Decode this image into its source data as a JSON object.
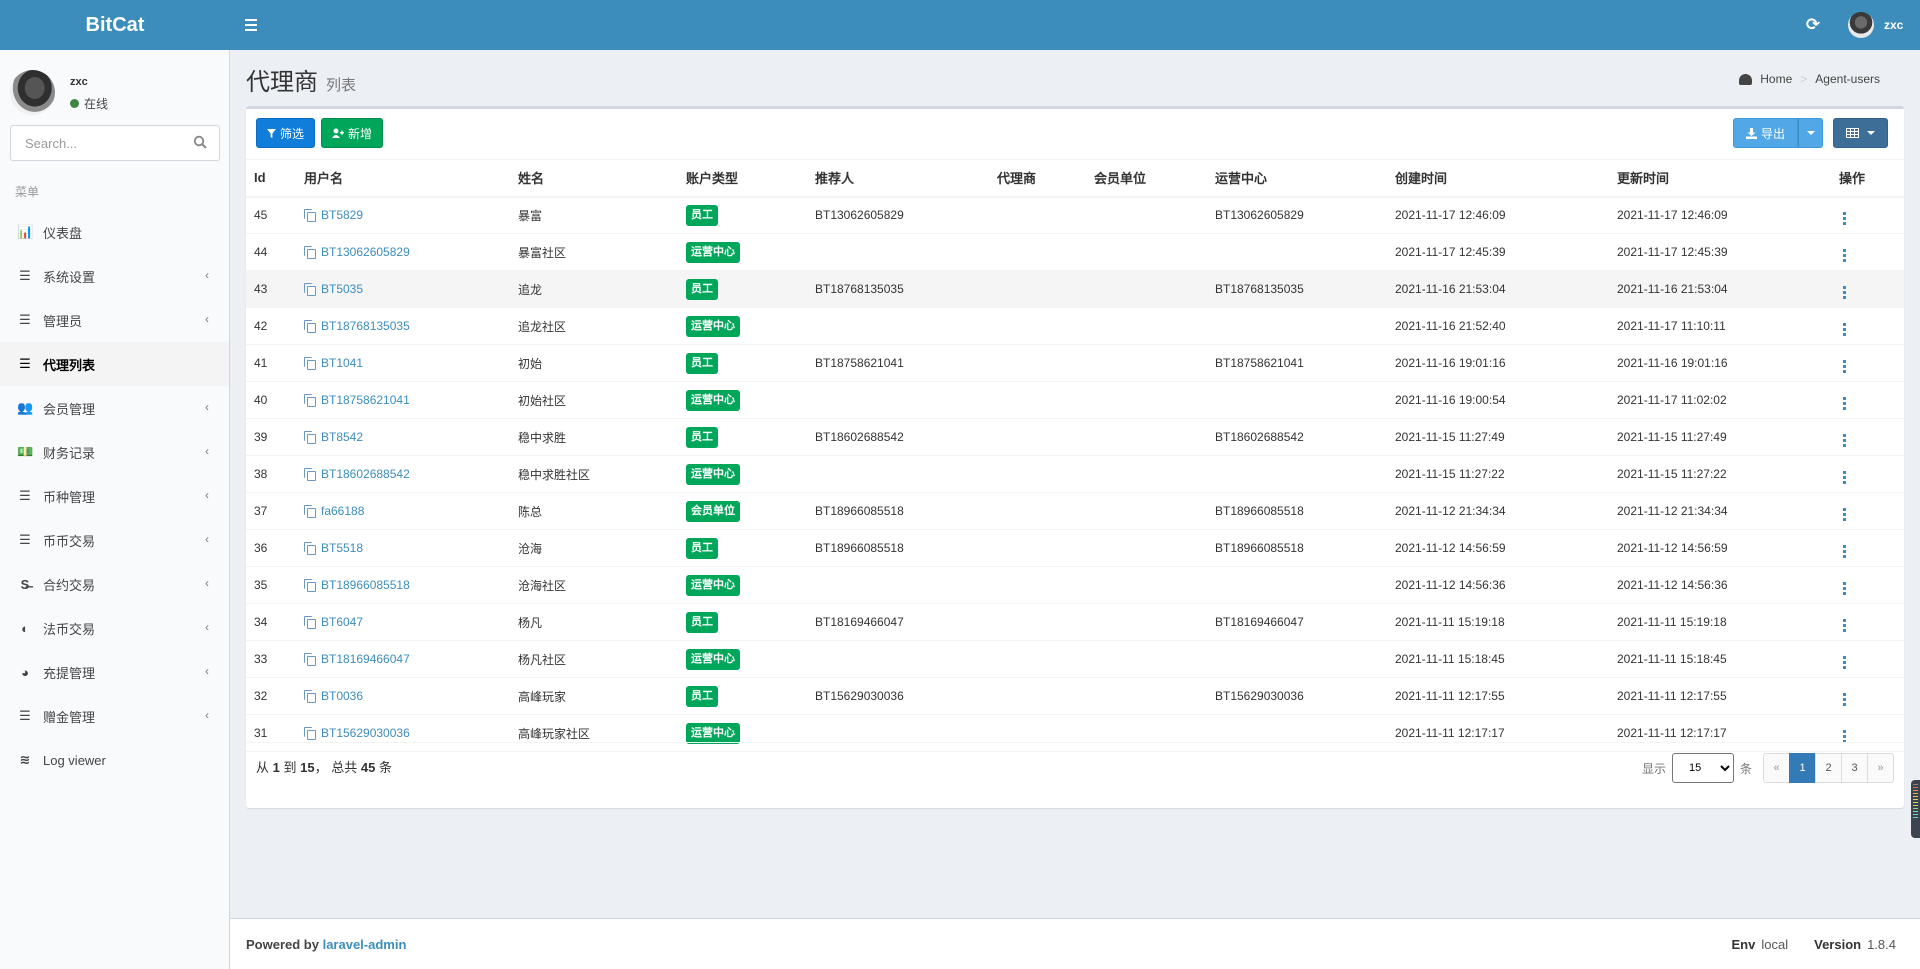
{
  "header": {
    "logo": "BitCat",
    "username": "zxc"
  },
  "sidebar": {
    "user": {
      "name": "zxc",
      "status": "在线"
    },
    "search_placeholder": "Search...",
    "menu_header": "菜单",
    "items": [
      {
        "label": "仪表盘",
        "icon": "bar-chart-icon",
        "glyph": "📊",
        "has_children": false,
        "active": false
      },
      {
        "label": "系统设置",
        "icon": "sliders-icon",
        "glyph": "☰",
        "has_children": true,
        "active": false
      },
      {
        "label": "管理员",
        "icon": "tasks-icon",
        "glyph": "☰",
        "has_children": true,
        "active": false
      },
      {
        "label": "代理列表",
        "icon": "bars-icon",
        "glyph": "☰",
        "has_children": false,
        "active": true
      },
      {
        "label": "会员管理",
        "icon": "users-icon",
        "glyph": "👥",
        "has_children": true,
        "active": false
      },
      {
        "label": "财务记录",
        "icon": "money-icon",
        "glyph": "💵",
        "has_children": true,
        "active": false
      },
      {
        "label": "币种管理",
        "icon": "bars-icon",
        "glyph": "☰",
        "has_children": true,
        "active": false
      },
      {
        "label": "币币交易",
        "icon": "bars-icon",
        "glyph": "☰",
        "has_children": true,
        "active": false
      },
      {
        "label": "合约交易",
        "icon": "strikethrough-icon",
        "glyph": "S̶",
        "has_children": true,
        "active": false
      },
      {
        "label": "法币交易",
        "icon": "adjust-icon",
        "glyph": "◐",
        "has_children": true,
        "active": false
      },
      {
        "label": "充提管理",
        "icon": "dashboard-icon",
        "glyph": "◕",
        "has_children": true,
        "active": false
      },
      {
        "label": "赠金管理",
        "icon": "bars-icon",
        "glyph": "☰",
        "has_children": true,
        "active": false
      },
      {
        "label": "Log viewer",
        "icon": "database-icon",
        "glyph": "≋",
        "has_children": false,
        "active": false
      }
    ]
  },
  "page": {
    "title": "代理商",
    "subtitle": "列表",
    "breadcrumb": [
      "Home",
      "Agent-users"
    ]
  },
  "toolbar": {
    "filter_label": "筛选",
    "new_label": "新增",
    "export_label": "导出"
  },
  "table": {
    "columns": [
      "Id",
      "用户名",
      "姓名",
      "账户类型",
      "推荐人",
      "代理商",
      "会员单位",
      "运营中心",
      "创建时间",
      "更新时间",
      "操作"
    ],
    "rows": [
      {
        "id": "45",
        "username": "BT5829",
        "name": "暴富",
        "type": "员工",
        "referrer": "BT13062605829",
        "agent": "",
        "member_unit": "",
        "ops_center": "BT13062605829",
        "created": "2021-11-17 12:46:09",
        "updated": "2021-11-17 12:46:09"
      },
      {
        "id": "44",
        "username": "BT13062605829",
        "name": "暴富社区",
        "type": "运营中心",
        "referrer": "",
        "agent": "",
        "member_unit": "",
        "ops_center": "",
        "created": "2021-11-17 12:45:39",
        "updated": "2021-11-17 12:45:39"
      },
      {
        "id": "43",
        "username": "BT5035",
        "name": "追龙",
        "type": "员工",
        "referrer": "BT18768135035",
        "agent": "",
        "member_unit": "",
        "ops_center": "BT18768135035",
        "created": "2021-11-16 21:53:04",
        "updated": "2021-11-16 21:53:04"
      },
      {
        "id": "42",
        "username": "BT18768135035",
        "name": "追龙社区",
        "type": "运营中心",
        "referrer": "",
        "agent": "",
        "member_unit": "",
        "ops_center": "",
        "created": "2021-11-16 21:52:40",
        "updated": "2021-11-17 11:10:11"
      },
      {
        "id": "41",
        "username": "BT1041",
        "name": "初始",
        "type": "员工",
        "referrer": "BT18758621041",
        "agent": "",
        "member_unit": "",
        "ops_center": "BT18758621041",
        "created": "2021-11-16 19:01:16",
        "updated": "2021-11-16 19:01:16"
      },
      {
        "id": "40",
        "username": "BT18758621041",
        "name": "初始社区",
        "type": "运营中心",
        "referrer": "",
        "agent": "",
        "member_unit": "",
        "ops_center": "",
        "created": "2021-11-16 19:00:54",
        "updated": "2021-11-17 11:02:02"
      },
      {
        "id": "39",
        "username": "BT8542",
        "name": "稳中求胜",
        "type": "员工",
        "referrer": "BT18602688542",
        "agent": "",
        "member_unit": "",
        "ops_center": "BT18602688542",
        "created": "2021-11-15 11:27:49",
        "updated": "2021-11-15 11:27:49"
      },
      {
        "id": "38",
        "username": "BT18602688542",
        "name": "稳中求胜社区",
        "type": "运营中心",
        "referrer": "",
        "agent": "",
        "member_unit": "",
        "ops_center": "",
        "created": "2021-11-15 11:27:22",
        "updated": "2021-11-15 11:27:22"
      },
      {
        "id": "37",
        "username": "fa66188",
        "name": "陈总",
        "type": "会员单位",
        "referrer": "BT18966085518",
        "agent": "",
        "member_unit": "",
        "ops_center": "BT18966085518",
        "created": "2021-11-12 21:34:34",
        "updated": "2021-11-12 21:34:34"
      },
      {
        "id": "36",
        "username": "BT5518",
        "name": "沧海",
        "type": "员工",
        "referrer": "BT18966085518",
        "agent": "",
        "member_unit": "",
        "ops_center": "BT18966085518",
        "created": "2021-11-12 14:56:59",
        "updated": "2021-11-12 14:56:59"
      },
      {
        "id": "35",
        "username": "BT18966085518",
        "name": "沧海社区",
        "type": "运营中心",
        "referrer": "",
        "agent": "",
        "member_unit": "",
        "ops_center": "",
        "created": "2021-11-12 14:56:36",
        "updated": "2021-11-12 14:56:36"
      },
      {
        "id": "34",
        "username": "BT6047",
        "name": "杨凡",
        "type": "员工",
        "referrer": "BT18169466047",
        "agent": "",
        "member_unit": "",
        "ops_center": "BT18169466047",
        "created": "2021-11-11 15:19:18",
        "updated": "2021-11-11 15:19:18"
      },
      {
        "id": "33",
        "username": "BT18169466047",
        "name": "杨凡社区",
        "type": "运营中心",
        "referrer": "",
        "agent": "",
        "member_unit": "",
        "ops_center": "",
        "created": "2021-11-11 15:18:45",
        "updated": "2021-11-11 15:18:45"
      },
      {
        "id": "32",
        "username": "BT0036",
        "name": "高峰玩家",
        "type": "员工",
        "referrer": "BT15629030036",
        "agent": "",
        "member_unit": "",
        "ops_center": "BT15629030036",
        "created": "2021-11-11 12:17:55",
        "updated": "2021-11-11 12:17:55"
      },
      {
        "id": "31",
        "username": "BT15629030036",
        "name": "高峰玩家社区",
        "type": "运营中心",
        "referrer": "",
        "agent": "",
        "member_unit": "",
        "ops_center": "",
        "created": "2021-11-11 12:17:17",
        "updated": "2021-11-11 12:17:17"
      }
    ],
    "hover_row_index": 2
  },
  "footer_bar": {
    "summary_prefix": "从",
    "from": "1",
    "to_word": "到",
    "to": "15",
    "total_word": "， 总共",
    "total": "45",
    "suffix": "条",
    "show_label": "显示",
    "per_page": "15",
    "per_page_suffix": "条",
    "pages": [
      "«",
      "1",
      "2",
      "3",
      "»"
    ],
    "current_page": "1"
  },
  "footer": {
    "powered_by": "Powered by",
    "powered_link": "laravel-admin",
    "env_label": "Env",
    "env_value": "local",
    "version_label": "Version",
    "version_value": "1.8.4"
  },
  "colors": {
    "brand": "#3c8dbc",
    "label_green": "#00a65a",
    "filter_blue": "#0f7dd9",
    "export_blue": "#52a8e6",
    "columns_btn": "#3c6e98",
    "page_active": "#337ab7"
  }
}
